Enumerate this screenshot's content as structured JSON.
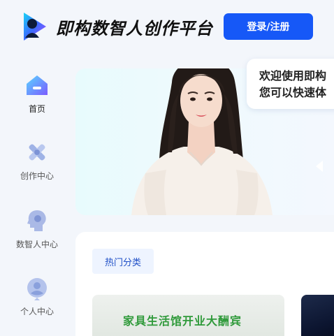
{
  "header": {
    "logo_text": "即构数智人创作平台",
    "login_label": "登录/注册"
  },
  "sidebar": {
    "items": [
      {
        "label": "首页",
        "icon": "home-icon",
        "active": true
      },
      {
        "label": "创作中心",
        "icon": "create-icon",
        "active": false
      },
      {
        "label": "数智人中心",
        "icon": "digital-human-icon",
        "active": false
      },
      {
        "label": "个人中心",
        "icon": "user-icon",
        "active": false
      }
    ]
  },
  "hero": {
    "greeting_line1": "欢迎使用即构",
    "greeting_line2": "您可以快速体"
  },
  "categories": {
    "tab_label": "热门分类",
    "cards": [
      {
        "title": "家具生活馆开业大酬宾"
      },
      {
        "title": ""
      }
    ]
  },
  "colors": {
    "primary": "#1658f7",
    "accent_green": "#2f9a3a",
    "tab_text": "#1f4fc7"
  }
}
